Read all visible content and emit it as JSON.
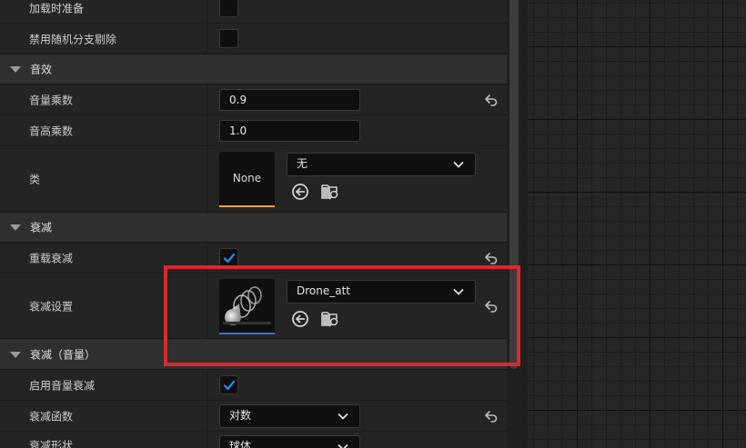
{
  "properties": {
    "load_prep_label": "加载时准备",
    "disable_random_branch_label": "禁用随机分支剔除",
    "sound_section_label": "音效",
    "volume_multiplier_label": "音量乘数",
    "volume_multiplier_value": "0.9",
    "pitch_multiplier_label": "音高乘数",
    "pitch_multiplier_value": "1.0",
    "class_label": "类",
    "class_thumb_text": "None",
    "class_dropdown_value": "无",
    "attenuation_section_label": "衰减",
    "override_attenuation_label": "重载衰减",
    "override_attenuation_checked": true,
    "attenuation_settings_label": "衰减设置",
    "attenuation_settings_value": "Drone_att",
    "attenuation_volume_section_label": "衰减（音量）",
    "enable_volume_attenuation_label": "启用音量衰减",
    "enable_volume_attenuation_checked": true,
    "attenuation_function_label": "衰减函数",
    "attenuation_function_value": "对数",
    "attenuation_shape_label": "衰减形状",
    "attenuation_shape_value": "球体"
  },
  "colors": {
    "highlight_border": "#e0262b",
    "checkmark": "#2a8ff7",
    "class_thumb_underline": "#e8a33a",
    "asset_thumb_underline": "#3f6fd6"
  },
  "icons": {
    "section_toggle": "triangle-down-icon",
    "reset": "reset-arrow-icon",
    "use_selected": "arrow-left-circle-icon",
    "browse": "folder-search-icon",
    "dropdown": "chevron-down-icon"
  }
}
